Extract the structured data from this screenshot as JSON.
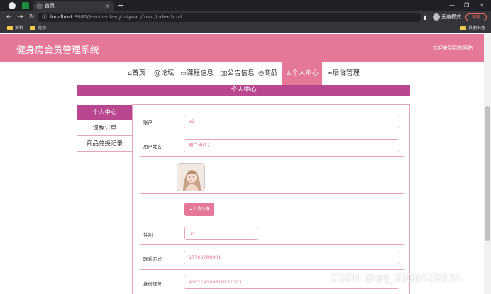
{
  "browser": {
    "tab_title": "首页",
    "new_tab_symbol": "+",
    "tab_close_symbol": "×",
    "url_host": "localhost",
    "url_path": ":8080/jianshenfanghuiyuan/front/index.html",
    "incognito_label": "无痕模式",
    "update_label": "更新",
    "bookmarks": [
      "资料",
      "常用"
    ],
    "other_bookmarks": "其他书签",
    "colors": {
      "tabbar": "#202124",
      "toolbar": "#35363a"
    }
  },
  "header": {
    "title": "健身房会员管理系统",
    "welcome": "欢迎来到我的网站"
  },
  "nav": {
    "items": [
      {
        "icon": "home-icon",
        "glyph": "⌂",
        "label": "首页"
      },
      {
        "icon": "forum-icon",
        "glyph": "@",
        "label": "论坛"
      },
      {
        "icon": "course-icon",
        "glyph": "▭",
        "label": "课程信息"
      },
      {
        "icon": "notice-icon",
        "glyph": "▯▯",
        "label": "公告信息"
      },
      {
        "icon": "shop-icon",
        "glyph": "◎",
        "label": "商品"
      },
      {
        "icon": "user-icon",
        "glyph": "♙",
        "label": "个人中心"
      },
      {
        "icon": "link-icon",
        "glyph": "∞",
        "label": "后台管理"
      }
    ],
    "active_index": 5
  },
  "panel": {
    "title": "个人中心"
  },
  "side_menu": {
    "items": [
      "个人中心",
      "课程订单",
      "商品兑换记录"
    ],
    "active_index": 0
  },
  "form": {
    "account": {
      "label": "账户",
      "value": "a1"
    },
    "username": {
      "label": "用户姓名",
      "value": "用户姓名1"
    },
    "upload_button": "上传头像",
    "gender": {
      "label": "性别",
      "value": "女"
    },
    "contact": {
      "label": "联系方式",
      "value": "17703786901"
    },
    "id_number": {
      "label": "身份证号",
      "value": "410224199610232001"
    }
  },
  "watermark": "CSDN @qq_3306428634",
  "colors": {
    "primary": "#e57799",
    "accent": "#b8478f",
    "border": "#e3a6bd"
  }
}
